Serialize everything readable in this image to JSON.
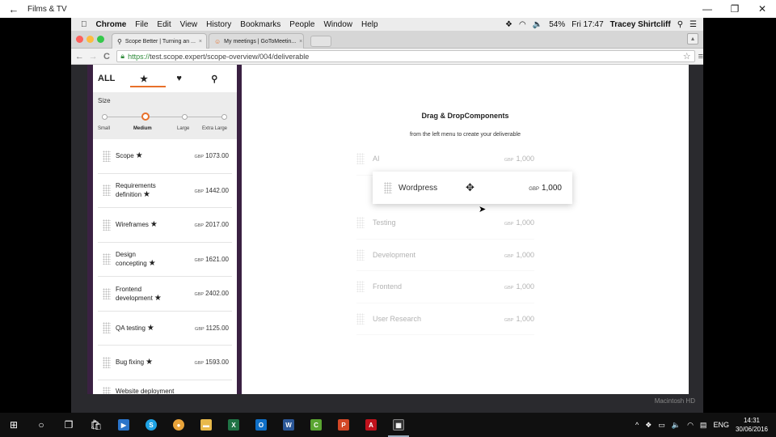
{
  "window": {
    "title": "Films & TV",
    "back_icon": "←",
    "minimize": "—",
    "restore": "❐",
    "close": "✕"
  },
  "mac_menubar": {
    "app": "Chrome",
    "items": [
      "File",
      "Edit",
      "View",
      "History",
      "Bookmarks",
      "People",
      "Window",
      "Help"
    ],
    "battery": "54%",
    "time": "Fri 17:47",
    "user": "Tracey Shirtcliff"
  },
  "browser": {
    "tabs": [
      {
        "label": "Scope Better | Turning an ...",
        "icon": "search-icon"
      },
      {
        "label": "My meetings | GoToMeetin...",
        "icon": "gotomeeting-icon"
      }
    ],
    "url_scheme": "https://",
    "url_rest": "test.scope.expert/scope-overview/004/deliverable"
  },
  "sidebar": {
    "filters": [
      "ALL",
      "★",
      "♥",
      "⚲"
    ],
    "size_label": "Size",
    "size_options": [
      "Small",
      "Medium",
      "Large",
      "Extra Large"
    ],
    "size_selected": "Medium",
    "currency": "GBP",
    "items": [
      {
        "name": "Scope",
        "star": "★",
        "price": "1073.00"
      },
      {
        "name": "Requirements definition",
        "star": "★",
        "price": "1442.00"
      },
      {
        "name": "Wireframes",
        "star": "★",
        "price": "2017.00"
      },
      {
        "name": "Design concepting",
        "star": "★",
        "price": "1621.00"
      },
      {
        "name": "Frontend development",
        "star": "★",
        "price": "2402.00"
      },
      {
        "name": "QA testing",
        "star": "★",
        "price": "1125.00"
      },
      {
        "name": "Bug fixing",
        "star": "★",
        "price": "1593.00"
      },
      {
        "name": "Website deployment",
        "star": "",
        "price": ""
      }
    ]
  },
  "main": {
    "title": "Drag & DropComponents",
    "subtitle": "from the left menu to create your deliverable",
    "currency": "GBP",
    "components": [
      {
        "name": "AI",
        "price": "1,000"
      },
      {
        "name": "",
        "price": ""
      },
      {
        "name": "Testing",
        "price": "1,000"
      },
      {
        "name": "Development",
        "price": "1,000"
      },
      {
        "name": "Frontend",
        "price": "1,000"
      },
      {
        "name": "User Research",
        "price": "1,000"
      }
    ],
    "dragging": {
      "name": "Wordpress",
      "price": "1,000",
      "move_icon": "✥"
    }
  },
  "mac_label": "Macintosh HD",
  "taskbar": {
    "language": "ENG",
    "time": "14:31",
    "date": "30/06/2016"
  }
}
